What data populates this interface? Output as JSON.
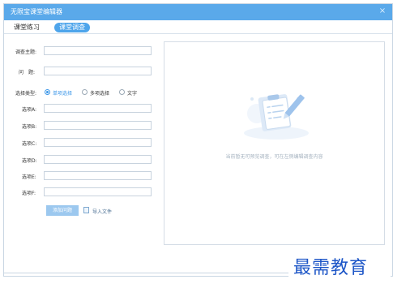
{
  "window": {
    "title": "无限宝课堂编辑器",
    "close_glyph": "×"
  },
  "tabs": [
    {
      "label": "课堂练习",
      "active": false
    },
    {
      "label": "课堂调查",
      "active": true
    }
  ],
  "form": {
    "topic_label": "调查主题:",
    "topic_value": "",
    "question_label": "问　题:",
    "question_value": "",
    "type_label": "选择类型:",
    "types": [
      {
        "label": "单项选择",
        "selected": true
      },
      {
        "label": "多项选择",
        "selected": false
      },
      {
        "label": "文字",
        "selected": false
      }
    ],
    "options": [
      {
        "label": "选项A:",
        "value": ""
      },
      {
        "label": "选项B:",
        "value": ""
      },
      {
        "label": "选项C:",
        "value": ""
      },
      {
        "label": "选项D:",
        "value": ""
      },
      {
        "label": "选项E:",
        "value": ""
      },
      {
        "label": "选项F:",
        "value": ""
      }
    ],
    "add_button": "添加问题",
    "import_label": "导入文件",
    "import_icon": "file-import-icon"
  },
  "preview": {
    "empty_message": "当前暂无可预览调查，可在左侧编辑调查内容",
    "illustration": "clipboard-pencil-illustration"
  },
  "watermark": {
    "text": "最需教育"
  },
  "colors": {
    "titlebar": "#5aa9ea",
    "accent": "#3c97e8",
    "tab_active_bg": "#4ea5eb",
    "button_bg": "#9cc8ef",
    "watermark": "#1d56c7"
  }
}
